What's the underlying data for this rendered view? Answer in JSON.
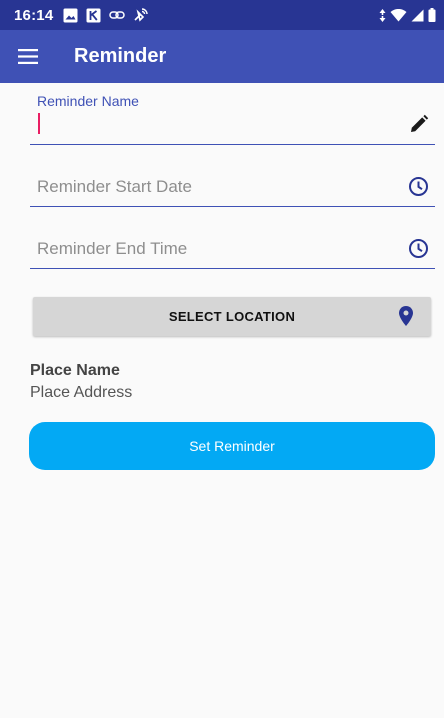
{
  "status_bar": {
    "time": "16:14",
    "left_icons": [
      "image-icon",
      "k-app-icon",
      "link-icon",
      "satellite-icon"
    ],
    "right_icons": [
      "data-arrows-icon",
      "wifi-icon",
      "signal-icon",
      "battery-icon"
    ]
  },
  "app_bar": {
    "menu_icon": "hamburger-menu-icon",
    "title": "Reminder"
  },
  "form": {
    "name_field": {
      "label": "Reminder Name",
      "value": "",
      "icon": "pencil-icon"
    },
    "start_date_field": {
      "placeholder": "Reminder Start Date",
      "icon": "clock-icon"
    },
    "end_time_field": {
      "placeholder": "Reminder End Time",
      "icon": "clock-icon"
    },
    "location_button": {
      "label": "SELECT LOCATION",
      "icon": "location-pin-icon"
    },
    "place": {
      "name": "Place Name",
      "address": "Place Address"
    },
    "submit_label": "Set Reminder"
  },
  "colors": {
    "status_bar": "#283593",
    "app_bar": "#3f51b5",
    "accent": "#e91e63",
    "button": "#03a9f4",
    "location_button": "#d6d6d6"
  }
}
